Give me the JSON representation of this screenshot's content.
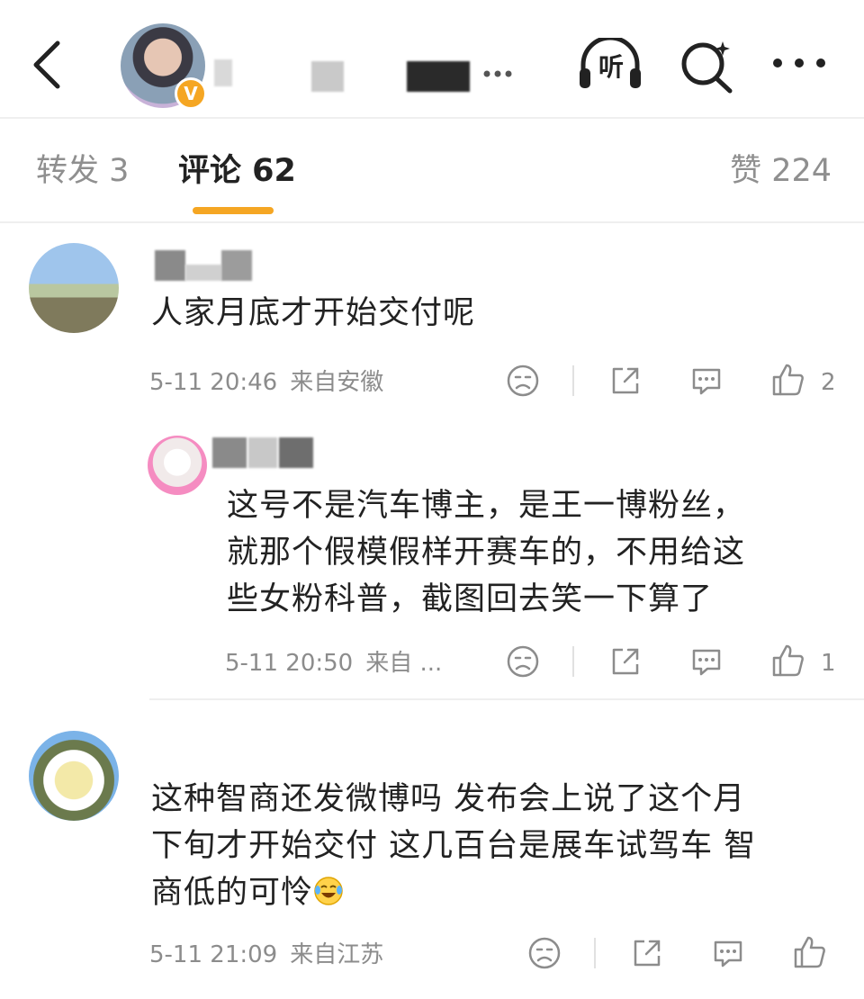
{
  "header": {
    "back_icon": "chevron-left-icon",
    "verified_badge": "V",
    "listen_label": "听",
    "listen_icon": "headphones-icon",
    "search_icon": "search-sparkle-icon",
    "more_icon": "more-dots-icon",
    "accent_color": "#f5a623"
  },
  "tabs": [
    {
      "label": "转发 3"
    },
    {
      "label": "评论 62"
    },
    {
      "label": "赞 224"
    }
  ],
  "comments": [
    {
      "text": "人家月底才开始交付呢",
      "time": "5-11 20:46",
      "location": "来自安徽",
      "like_count": "2"
    },
    {
      "lines": [
        "这号不是汽车博主，是王一博粉丝，",
        "就那个假模假样开赛车的，不用给这",
        "些女粉科普，截图回去笑一下算了"
      ],
      "time": "5-11 20:50",
      "location": "来自 ...",
      "like_count": "1"
    },
    {
      "lines": [
        "这种智商还发微博吗 发布会上说了这个月",
        "下旬才开始交付 这几百台是展车试驾车 智",
        "商低的可怜"
      ],
      "time": "5-11 21:09",
      "location": "来自江苏"
    }
  ]
}
